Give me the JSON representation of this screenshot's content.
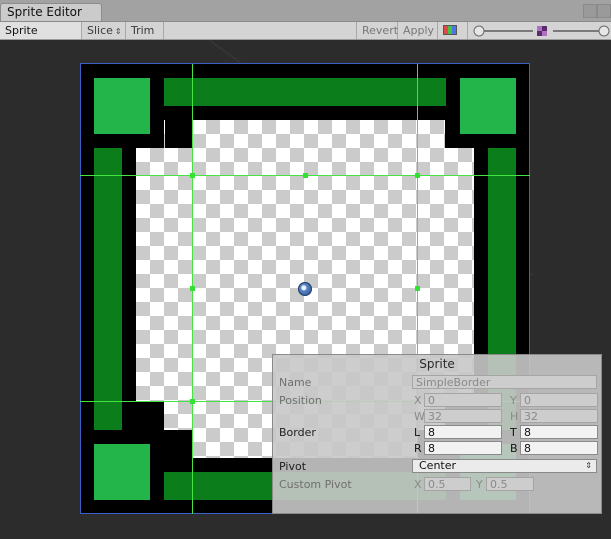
{
  "window": {
    "tab_title": "Sprite Editor"
  },
  "toolbar": {
    "mode_label": "Sprite Editor",
    "slice_label": "Slice",
    "trim_label": "Trim",
    "revert_label": "Revert",
    "apply_label": "Apply",
    "dropdown_arrow": "⇕",
    "color_channel_icon": "rgb-channel-icon",
    "zoom_icon": "mip-level-icon"
  },
  "sprite_panel": {
    "title": "Sprite",
    "name_label": "Name",
    "name_value": "SimpleBorder",
    "position_label": "Position",
    "x_axis": "X",
    "x_value": "0",
    "y_axis": "Y",
    "y_value": "0",
    "w_axis": "W",
    "w_value": "32",
    "h_axis": "H",
    "h_value": "32",
    "border_label": "Border",
    "l_axis": "L",
    "l_value": "8",
    "t_axis": "T",
    "t_value": "8",
    "r_axis": "R",
    "r_value": "8",
    "b_axis": "B",
    "b_value": "8",
    "pivot_label": "Pivot",
    "pivot_value": "Center",
    "custom_pivot_label": "Custom Pivot",
    "cx_axis": "X",
    "cx_value": "0.5",
    "cy_axis": "Y",
    "cy_value": "0.5"
  },
  "colors": {
    "border_green_dark": "#0b7d1a",
    "border_green_light": "#23b44a",
    "guide_green": "#43e543",
    "selection_blue": "#3b5fc9"
  }
}
